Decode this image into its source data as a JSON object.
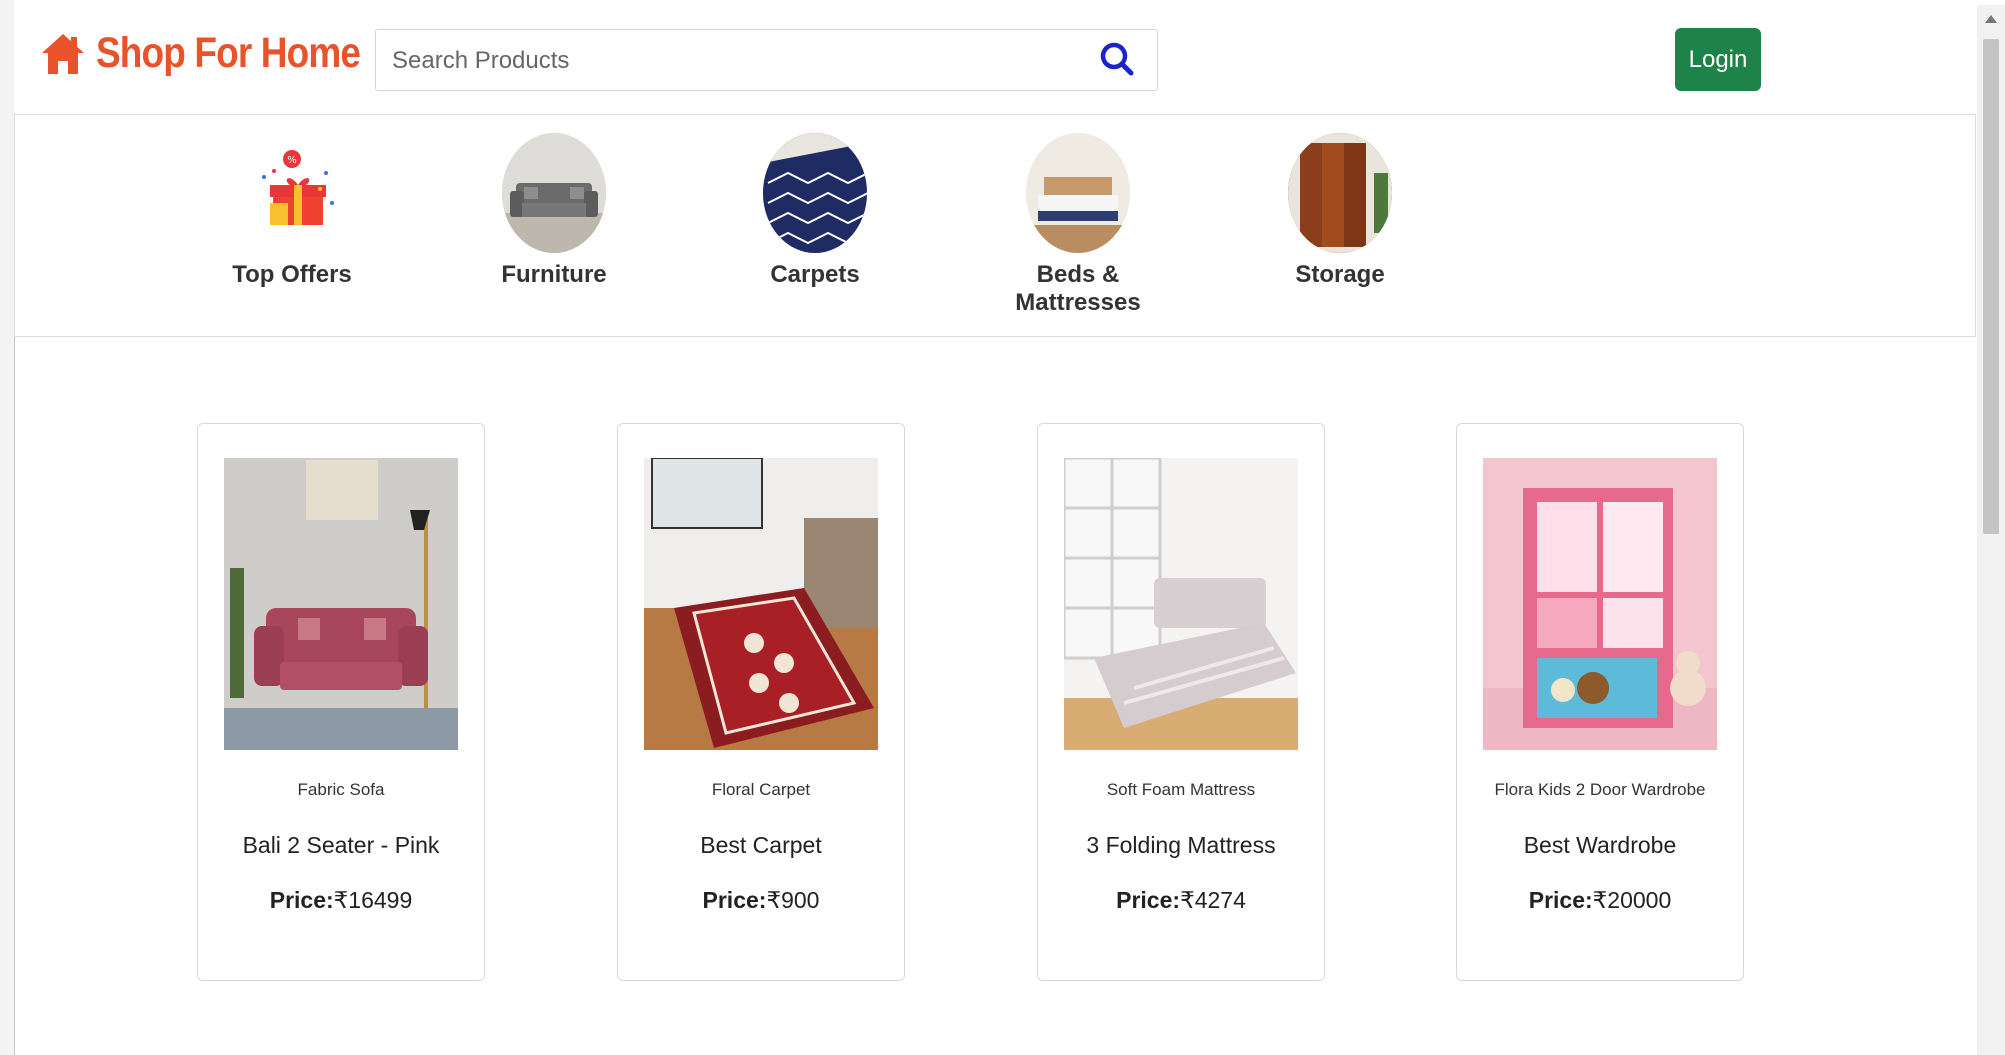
{
  "brand": {
    "name": "Shop For Home",
    "color": "#e8532b"
  },
  "search": {
    "placeholder": "Search Products",
    "value": ""
  },
  "header": {
    "login_label": "Login"
  },
  "categories": [
    {
      "label": "Top Offers",
      "icon": "gift-offers-icon"
    },
    {
      "label": "Furniture"
    },
    {
      "label": "Carpets"
    },
    {
      "label": "Beds & Mattresses"
    },
    {
      "label": "Storage"
    }
  ],
  "products": [
    {
      "subtitle": "Fabric Sofa",
      "name": "Bali 2 Seater - Pink",
      "price_label": "Price:",
      "price": "₹16499"
    },
    {
      "subtitle": "Floral Carpet",
      "name": "Best Carpet",
      "price_label": "Price:",
      "price": "₹900"
    },
    {
      "subtitle": "Soft Foam Mattress",
      "name": "3 Folding Mattress",
      "price_label": "Price:",
      "price": "₹4274"
    },
    {
      "subtitle": "Flora Kids 2 Door Wardrobe",
      "name": "Best Wardrobe",
      "price_label": "Price:",
      "price": "₹20000"
    }
  ],
  "colors": {
    "accent": "#e8532b",
    "login_bg": "#1d8348",
    "search_icon": "#1a24c9"
  }
}
